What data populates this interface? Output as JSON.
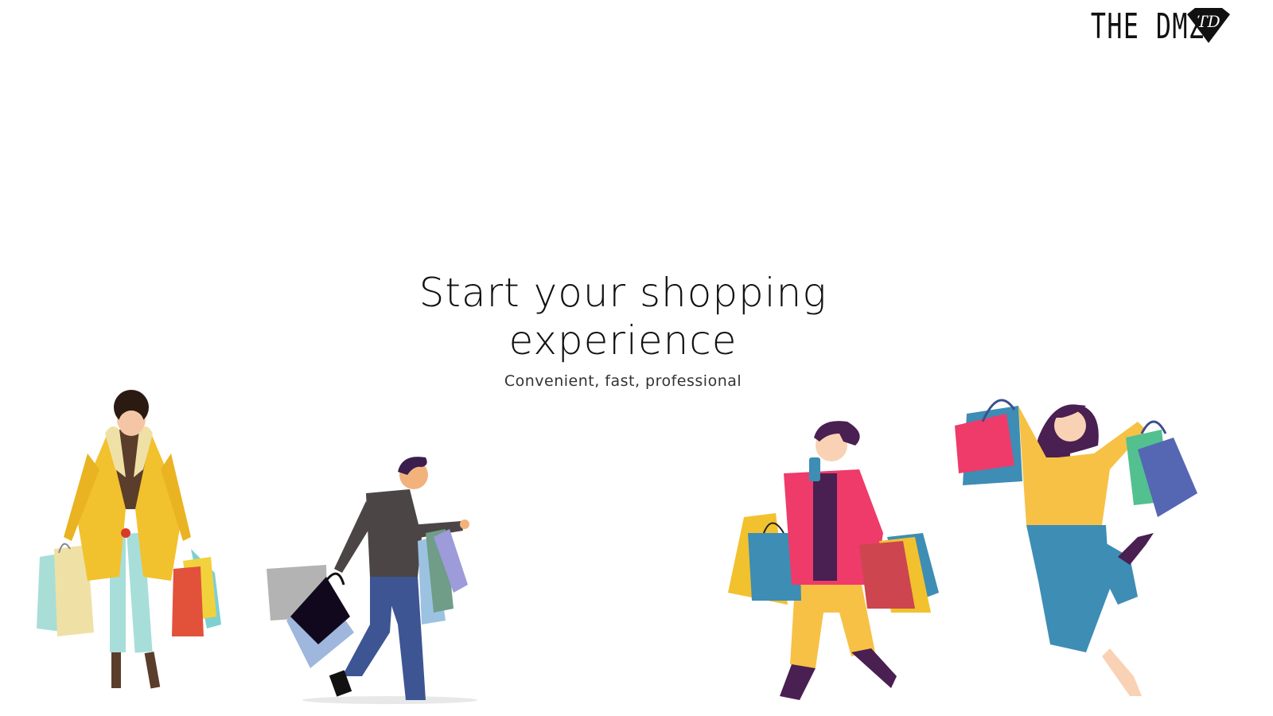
{
  "header": {
    "logo_text": "THE DMZ",
    "logo_mark_icon": "diamond-td-monogram-icon",
    "logo_mark_text": "TD"
  },
  "hero": {
    "title_line1": "Start your shopping",
    "title_line2": "experience",
    "subtitle": "Convenient, fast, professional"
  },
  "illustrations": [
    {
      "name": "woman-yellow-coat-with-bags",
      "icon": "shopper-illustration"
    },
    {
      "name": "man-walking-with-bags",
      "icon": "shopper-illustration"
    },
    {
      "name": "man-pink-jacket-with-bags",
      "icon": "shopper-illustration"
    },
    {
      "name": "woman-jumping-with-bags",
      "icon": "shopper-illustration"
    }
  ],
  "colors": {
    "background": "#ffffff",
    "text": "#111111",
    "yellow": "#f2c12e",
    "pink": "#ee3b6a",
    "blue": "#3d8db5",
    "navy": "#3e4f8e",
    "purple": "#4a1f52"
  }
}
